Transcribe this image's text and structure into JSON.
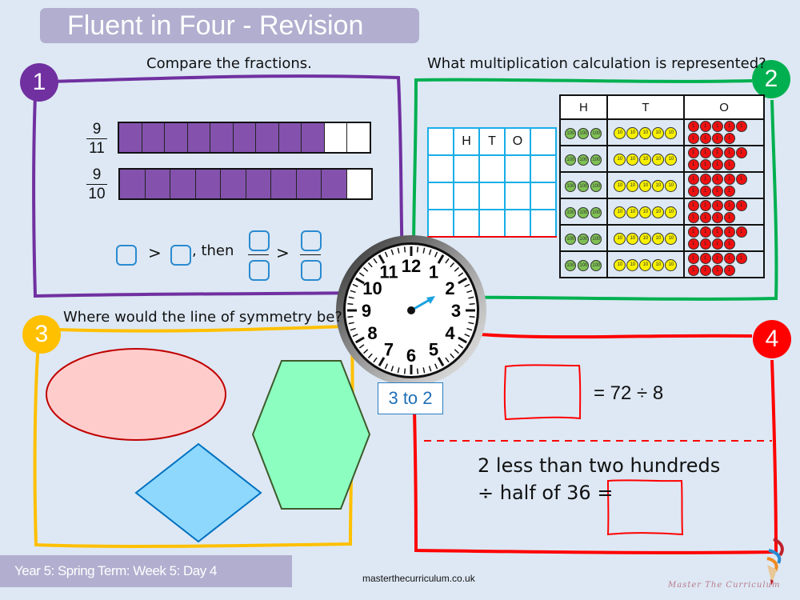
{
  "header": {
    "title": "Fluent in Four - Revision"
  },
  "colors": {
    "q1": "#7030a0",
    "q2": "#00b050",
    "q3": "#ffc000",
    "q4": "#ff0000",
    "title_bar": "#b1aecf",
    "background": "#dde8f4",
    "fraction_fill": "#8452ad",
    "answer_box": "#2a8ad0"
  },
  "q1": {
    "number": "1",
    "prompt": "Compare the fractions.",
    "fractions": [
      {
        "numerator": "9",
        "denominator": "11",
        "shaded": 9,
        "total": 11
      },
      {
        "numerator": "9",
        "denominator": "10",
        "shaded": 9,
        "total": 10
      }
    ],
    "comparison": {
      "symbol1": ">",
      "then": ", then",
      "symbol2": ">"
    }
  },
  "q2": {
    "number": "2",
    "prompt": "What multiplication calculation is represented?",
    "blank_grid": {
      "headers": [
        "",
        "H",
        "T",
        "O",
        ""
      ],
      "rows": 3
    },
    "place_value_chart": {
      "headers": [
        "H",
        "T",
        "O"
      ],
      "rows": [
        {
          "hundreds": 3,
          "tens": 5,
          "ones": 9
        },
        {
          "hundreds": 3,
          "tens": 5,
          "ones": 9
        },
        {
          "hundreds": 3,
          "tens": 5,
          "ones": 9
        },
        {
          "hundreds": 3,
          "tens": 5,
          "ones": 9
        },
        {
          "hundreds": 3,
          "tens": 5,
          "ones": 9
        },
        {
          "hundreds": 3,
          "tens": 5,
          "ones": 9
        }
      ],
      "counter_labels": {
        "hundreds": "100",
        "tens": "10",
        "ones": "1"
      }
    }
  },
  "clock": {
    "numbers": [
      "12",
      "1",
      "2",
      "3",
      "4",
      "5",
      "6",
      "7",
      "8",
      "9",
      "10",
      "11"
    ],
    "hand_points_to": 2,
    "label": "3 to 2"
  },
  "q3": {
    "number": "3",
    "prompt": "Where would the line of symmetry be?",
    "shapes": [
      {
        "type": "ellipse",
        "fill": "#ffcccc",
        "stroke": "#c00000"
      },
      {
        "type": "rhombus",
        "fill": "#8dd8fc",
        "stroke": "#0070c0"
      },
      {
        "type": "hexagon",
        "fill": "#8cffc0",
        "stroke": "#3d5a2a"
      }
    ]
  },
  "q4": {
    "number": "4",
    "equation1": "= 72 ÷ 8",
    "line1": "2 less than two hundreds",
    "line2": "÷ half of 36 ="
  },
  "footer": {
    "lesson": "Year 5: Spring Term: Week 5: Day 4",
    "website": "masterthecurriculum.co.uk",
    "brand": "Master  The  Curriculum"
  }
}
